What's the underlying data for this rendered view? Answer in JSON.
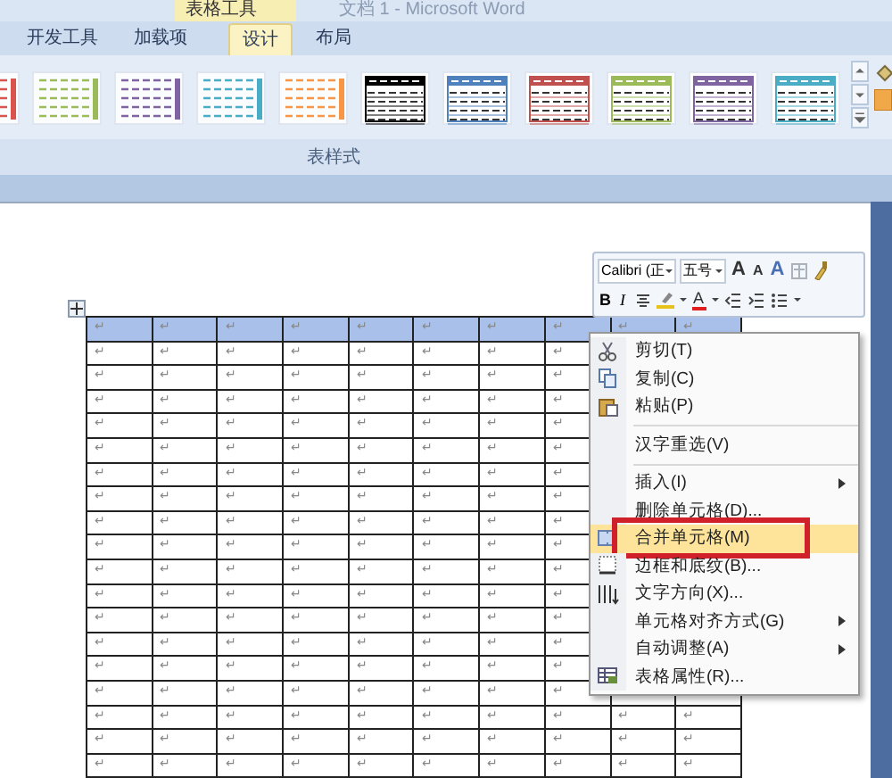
{
  "window": {
    "title": "文档 1 - Microsoft Word",
    "context_tab": "表格工具"
  },
  "tabs": [
    {
      "label": "开发工具",
      "selected": false
    },
    {
      "label": "加载项",
      "selected": false
    },
    {
      "label": "设计",
      "selected": true
    },
    {
      "label": "布局",
      "selected": false
    }
  ],
  "gallery": {
    "group_label": "表样式",
    "styles": [
      {
        "kind": "light",
        "color": "#d9534f"
      },
      {
        "kind": "light",
        "color": "#9bbb59"
      },
      {
        "kind": "light",
        "color": "#8064a2"
      },
      {
        "kind": "light",
        "color": "#4bacc6"
      },
      {
        "kind": "light",
        "color": "#f79646"
      },
      {
        "kind": "dark",
        "color": "#000000"
      },
      {
        "kind": "dark",
        "color": "#4f81bd"
      },
      {
        "kind": "dark",
        "color": "#c0504d"
      },
      {
        "kind": "dark",
        "color": "#9bbb59"
      },
      {
        "kind": "dark",
        "color": "#8064a2"
      },
      {
        "kind": "dark",
        "color": "#4bacc6"
      }
    ]
  },
  "mini_toolbar": {
    "font": "Calibri (正",
    "size": "五号",
    "row1_letters": [
      "A",
      "A",
      "A"
    ],
    "bold": "B",
    "italic": "I",
    "font_color": "A"
  },
  "context_menu": {
    "items": [
      {
        "kind": "item",
        "label": "剪切(T)",
        "submenu": false,
        "selected": false,
        "annotated": false
      },
      {
        "kind": "item",
        "label": "复制(C)",
        "submenu": false,
        "selected": false,
        "annotated": false
      },
      {
        "kind": "item",
        "label": "粘贴(P)",
        "submenu": false,
        "selected": false,
        "annotated": false
      },
      {
        "kind": "separator"
      },
      {
        "kind": "item",
        "label": "汉字重选(V)",
        "submenu": false,
        "selected": false,
        "annotated": false
      },
      {
        "kind": "separator"
      },
      {
        "kind": "item",
        "label": "插入(I)",
        "submenu": true,
        "selected": false,
        "annotated": false
      },
      {
        "kind": "item",
        "label": "删除单元格(D)...",
        "submenu": false,
        "selected": false,
        "annotated": false
      },
      {
        "kind": "item",
        "label": "合并单元格(M)",
        "submenu": false,
        "selected": true,
        "annotated": true
      },
      {
        "kind": "item",
        "label": "边框和底纹(B)...",
        "submenu": false,
        "selected": false,
        "annotated": false
      },
      {
        "kind": "item",
        "label": "文字方向(X)...",
        "submenu": false,
        "selected": false,
        "annotated": false
      },
      {
        "kind": "item",
        "label": "单元格对齐方式(G)",
        "submenu": true,
        "selected": false,
        "annotated": false
      },
      {
        "kind": "item",
        "label": "自动调整(A)",
        "submenu": true,
        "selected": false,
        "annotated": false
      },
      {
        "kind": "item",
        "label": "表格属性(R)...",
        "submenu": false,
        "selected": false,
        "annotated": false
      }
    ]
  },
  "table": {
    "rows": [
      {
        "selected": true,
        "cells": [
          "↵",
          "↵",
          "↵",
          "↵",
          "↵",
          "↵",
          "↵",
          "↵",
          "↵",
          "↵"
        ]
      },
      {
        "selected": false,
        "cells": [
          "↵",
          "↵",
          "↵",
          "↵",
          "↵",
          "↵",
          "↵",
          "↵",
          null,
          null
        ]
      },
      {
        "selected": false,
        "cells": [
          "↵",
          "↵",
          "↵",
          "↵",
          "↵",
          "↵",
          "↵",
          "↵",
          null,
          null
        ]
      },
      {
        "selected": false,
        "cells": [
          "↵",
          "↵",
          "↵",
          "↵",
          "↵",
          "↵",
          "↵",
          "↵",
          null,
          null
        ]
      },
      {
        "selected": false,
        "cells": [
          "↵",
          "↵",
          "↵",
          "↵",
          "↵",
          "↵",
          "↵",
          "↵",
          null,
          null
        ]
      },
      {
        "selected": false,
        "cells": [
          "↵",
          "↵",
          "↵",
          "↵",
          "↵",
          "↵",
          "↵",
          "↵",
          null,
          null
        ]
      },
      {
        "selected": false,
        "cells": [
          "↵",
          "↵",
          "↵",
          "↵",
          "↵",
          "↵",
          "↵",
          "↵",
          null,
          null
        ]
      },
      {
        "selected": false,
        "cells": [
          "↵",
          "↵",
          "↵",
          "↵",
          "↵",
          "↵",
          "↵",
          "↵",
          null,
          null
        ]
      },
      {
        "selected": false,
        "cells": [
          "↵",
          "↵",
          "↵",
          "↵",
          "↵",
          "↵",
          "↵",
          "↵",
          null,
          null
        ]
      },
      {
        "selected": false,
        "cells": [
          "↵",
          "↵",
          "↵",
          "↵",
          "↵",
          "↵",
          "↵",
          "↵",
          null,
          null
        ]
      },
      {
        "selected": false,
        "cells": [
          "↵",
          "↵",
          "↵",
          "↵",
          "↵",
          "↵",
          "↵",
          "↵",
          null,
          null
        ]
      },
      {
        "selected": false,
        "cells": [
          "↵",
          "↵",
          "↵",
          "↵",
          "↵",
          "↵",
          "↵",
          "↵",
          null,
          null
        ]
      },
      {
        "selected": false,
        "cells": [
          "↵",
          "↵",
          "↵",
          "↵",
          "↵",
          "↵",
          "↵",
          "↵",
          null,
          null
        ]
      },
      {
        "selected": false,
        "cells": [
          "↵",
          "↵",
          "↵",
          "↵",
          "↵",
          "↵",
          "↵",
          "↵",
          null,
          null
        ]
      },
      {
        "selected": false,
        "cells": [
          "↵",
          "↵",
          "↵",
          "↵",
          "↵",
          "↵",
          "↵",
          "↵",
          null,
          null
        ]
      },
      {
        "selected": false,
        "cells": [
          "↵",
          "↵",
          "↵",
          "↵",
          "↵",
          "↵",
          "↵",
          "↵",
          null,
          null
        ]
      },
      {
        "selected": false,
        "cells": [
          "↵",
          "↵",
          "↵",
          "↵",
          "↵",
          "↵",
          "↵",
          "↵",
          "↵",
          "↵"
        ]
      },
      {
        "selected": false,
        "cells": [
          "↵",
          "↵",
          "↵",
          "↵",
          "↵",
          "↵",
          "↵",
          "↵",
          "↵",
          "↵"
        ]
      },
      {
        "selected": false,
        "cells": [
          "↵",
          "↵",
          "↵",
          "↵",
          "↵",
          "↵",
          "↵",
          "↵",
          "↵",
          "↵"
        ]
      }
    ]
  }
}
